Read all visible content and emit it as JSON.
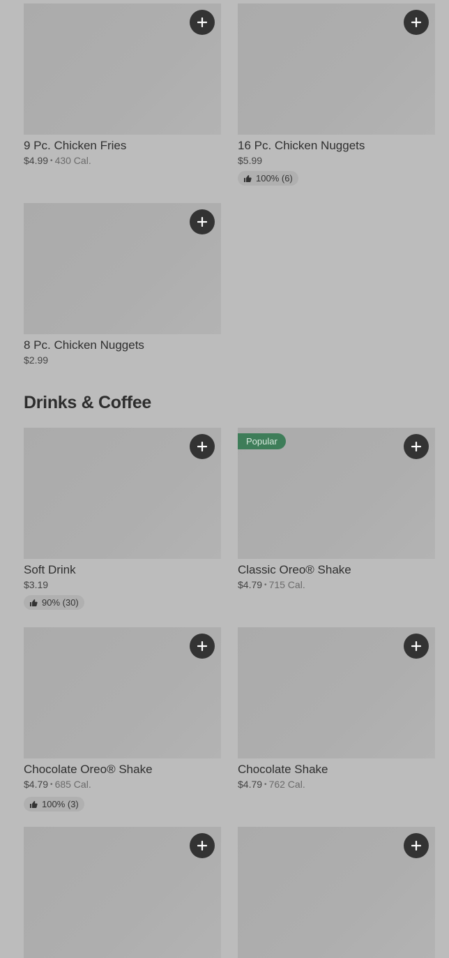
{
  "top_items": [
    {
      "name": "9 Pc. Chicken Fries",
      "price": "$4.99",
      "calories": "430 Cal.",
      "rating": ""
    },
    {
      "name": "16 Pc. Chicken Nuggets",
      "price": "$5.99",
      "calories": "",
      "rating": "100% (6)"
    },
    {
      "name": "8 Pc. Chicken Nuggets",
      "price": "$2.99",
      "calories": "",
      "rating": ""
    }
  ],
  "drinks_section": {
    "title": "Drinks & Coffee",
    "items": [
      {
        "name": "Soft Drink",
        "price": "$3.19",
        "calories": "",
        "rating": "90% (30)",
        "badge": ""
      },
      {
        "name": "Classic Oreo® Shake",
        "price": "$4.79",
        "calories": "715 Cal.",
        "rating": "",
        "badge": "Popular"
      },
      {
        "name": "Chocolate Oreo® Shake",
        "price": "$4.79",
        "calories": "685 Cal.",
        "rating": "100% (3)",
        "badge": ""
      },
      {
        "name": "Chocolate Shake",
        "price": "$4.79",
        "calories": "762 Cal.",
        "rating": "",
        "badge": ""
      }
    ]
  },
  "colors": {
    "background": "#bcbcbc",
    "add_button": "#333333",
    "badge": "#3e7d59"
  },
  "icons": {
    "add": "plus-icon",
    "rating": "thumbs-up-icon"
  }
}
